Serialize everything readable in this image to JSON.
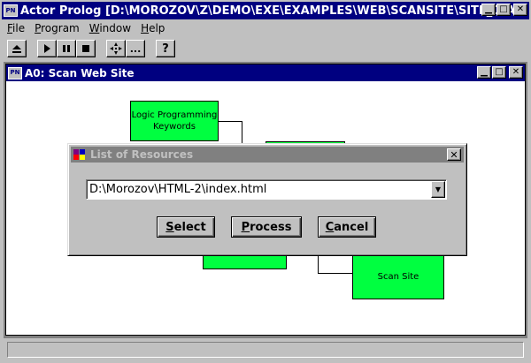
{
  "app": {
    "title": "Actor Prolog [D:\\MOROZOV\\Z\\DEMO\\EXE\\EXAMPLES\\WEB\\SCANSITE\\SITE_D.A]",
    "icon_label": "PN"
  },
  "menu": {
    "file": {
      "accel": "F",
      "rest": "ile"
    },
    "program": {
      "accel": "P",
      "rest": "rogram"
    },
    "window": {
      "accel": "W",
      "rest": "indow"
    },
    "help": {
      "accel": "H",
      "rest": "elp"
    }
  },
  "toolbar": {
    "icons": [
      "eject-icon",
      "play-icon",
      "pause-icon",
      "stop-icon",
      "step-icon",
      "more-icon",
      "help-icon"
    ],
    "more_label": "...",
    "help_label": "?"
  },
  "child_window": {
    "title": "A0: Scan Web Site",
    "icon_label": "PN"
  },
  "diagram": {
    "nodes": [
      {
        "id": "keywords",
        "label_line1": "Logic Programming",
        "label_line2": "Keywords"
      },
      {
        "id": "scan",
        "label": "Scan Site"
      }
    ],
    "node_color": "#00ff40"
  },
  "dialog": {
    "title": "List of Resources",
    "combo_value": "D:\\Morozov\\HTML-2\\index.html",
    "buttons": {
      "select": {
        "accel": "S",
        "rest": "elect"
      },
      "process": {
        "accel": "P",
        "rest": "rocess"
      },
      "cancel": {
        "accel": "C",
        "rest": "ancel"
      }
    }
  },
  "colors": {
    "title_active": "#000080",
    "title_inactive": "#808080",
    "face": "#c0c0c0"
  }
}
